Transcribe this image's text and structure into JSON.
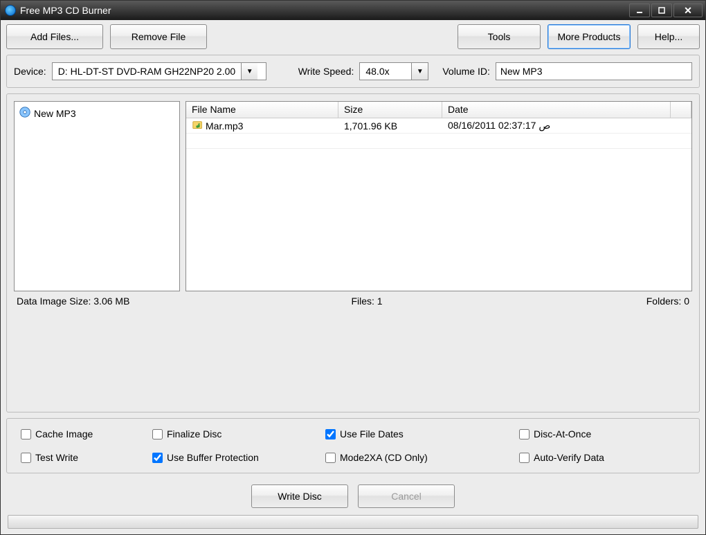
{
  "title": "Free MP3 CD Burner",
  "toolbar": {
    "add_files": "Add Files...",
    "remove_file": "Remove File",
    "tools": "Tools",
    "more_products": "More Products",
    "help": "Help..."
  },
  "device_row": {
    "device_label": "Device:",
    "device_value": "D: HL-DT-ST DVD-RAM GH22NP20 2.00",
    "write_speed_label": "Write Speed:",
    "write_speed_value": "48.0x",
    "volume_id_label": "Volume ID:",
    "volume_id_value": "New MP3"
  },
  "tree": {
    "root": "New MP3"
  },
  "columns": {
    "filename": "File Name",
    "size": "Size",
    "date": "Date"
  },
  "files": [
    {
      "name": "Mar.mp3",
      "size": "1,701.96 KB",
      "date": "08/16/2011 02:37:17 ص"
    }
  ],
  "status": {
    "data_image_size": "Data Image Size: 3.06 MB",
    "files": "Files: 1",
    "folders": "Folders: 0"
  },
  "options": {
    "cache_image": "Cache Image",
    "test_write": "Test Write",
    "finalize_disc": "Finalize Disc",
    "use_buffer_protection": "Use Buffer Protection",
    "use_file_dates": "Use File Dates",
    "mode2xa": "Mode2XA (CD Only)",
    "disc_at_once": "Disc-At-Once",
    "auto_verify": "Auto-Verify Data"
  },
  "option_states": {
    "cache_image": false,
    "test_write": false,
    "finalize_disc": false,
    "use_buffer_protection": true,
    "use_file_dates": true,
    "mode2xa": false,
    "disc_at_once": false,
    "auto_verify": false
  },
  "actions": {
    "write_disc": "Write Disc",
    "cancel": "Cancel"
  }
}
